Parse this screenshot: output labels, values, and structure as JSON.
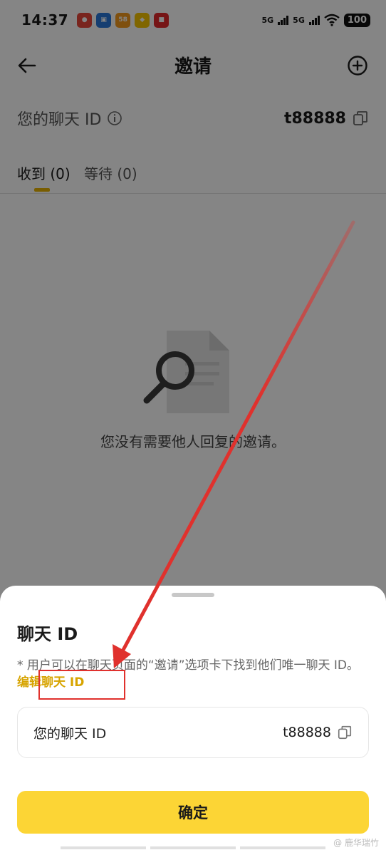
{
  "status_bar": {
    "time": "14:37",
    "net1": "5G",
    "net2": "5G",
    "battery": "100"
  },
  "header": {
    "title": "邀请"
  },
  "chat_id_row": {
    "label": "您的聊天 ID",
    "value": "t88888"
  },
  "tabs": [
    {
      "label": "收到 (0)"
    },
    {
      "label": "等待 (0)"
    }
  ],
  "empty_state": {
    "text": "您没有需要他人回复的邀请。"
  },
  "sheet": {
    "title": "聊天 ID",
    "note_text": "* 用户可以在聊天页面的“邀请”选项卡下找到他们唯一聊天 ID。",
    "edit_link": "编辑聊天 ID",
    "card_label": "您的聊天 ID",
    "card_value": "t88888",
    "confirm_label": "确定"
  },
  "watermark": "@ 鹿华瑞竹",
  "colors": {
    "accent": "#fcd535",
    "link": "#d7a400",
    "annotation": "#e0312d"
  }
}
